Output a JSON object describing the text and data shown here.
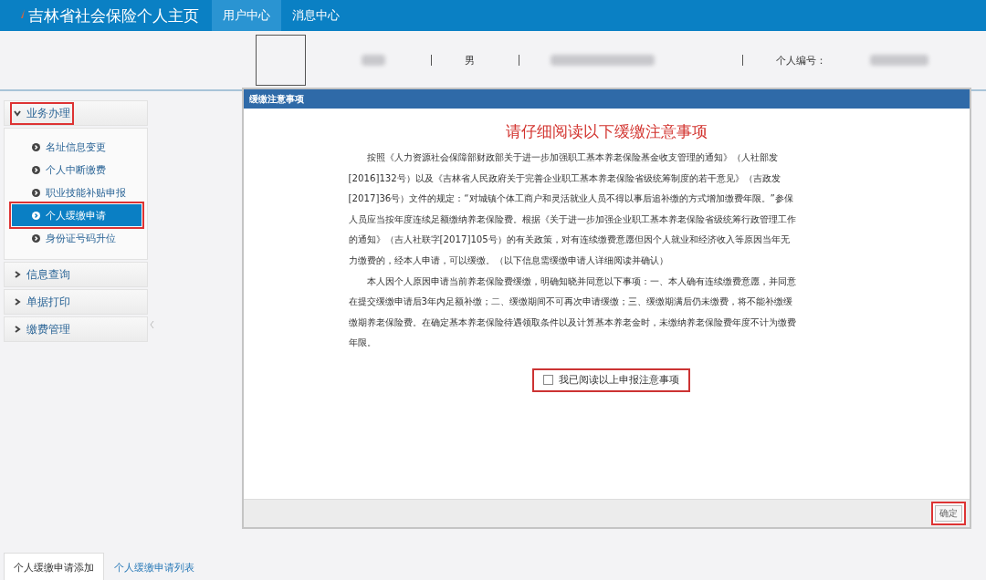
{
  "header": {
    "title": "吉林省社会保险个人主页",
    "nav": [
      {
        "label": "用户中心",
        "selected": true
      },
      {
        "label": "消息中心",
        "selected": false
      }
    ]
  },
  "profile": {
    "gender": "男",
    "id_label": "个人编号："
  },
  "sidebar": {
    "groups": [
      {
        "label": "业务办理",
        "expanded": true,
        "highlighted": true,
        "items": [
          {
            "label": "名址信息变更",
            "selected": false,
            "highlighted": false
          },
          {
            "label": "个人中断缴费",
            "selected": false,
            "highlighted": false
          },
          {
            "label": "职业技能补贴申报",
            "selected": false,
            "highlighted": false
          },
          {
            "label": "个人缓缴申请",
            "selected": true,
            "highlighted": true
          },
          {
            "label": "身份证号码升位",
            "selected": false,
            "highlighted": false
          }
        ]
      },
      {
        "label": "信息查询",
        "expanded": false,
        "highlighted": false
      },
      {
        "label": "单据打印",
        "expanded": false,
        "highlighted": false
      },
      {
        "label": "缴费管理",
        "expanded": false,
        "highlighted": false
      }
    ]
  },
  "dialog": {
    "title": "缓缴注意事项",
    "heading": "请仔细阅读以下缓缴注意事项",
    "paragraphs": [
      "按照《人力资源社会保障部财政部关于进一步加强职工基本养老保险基金收支管理的通知》（人社部发[2016]132号）以及《吉林省人民政府关于完善企业职工基本养老保险省级统筹制度的若干意见》（吉政发[2017]36号）文件的规定：“对城镇个体工商户和灵活就业人员不得以事后追补缴的方式增加缴费年限。”参保人员应当按年度连续足额缴纳养老保险费。根据《关于进一步加强企业职工基本养老保险省级统筹行政管理工作的通知》（吉人社联字[2017]105号）的有关政策，对有连续缴费意愿但因个人就业和经济收入等原因当年无力缴费的，经本人申请，可以缓缴。（以下信息需缓缴申请人详细阅读并确认）",
      "本人因个人原因申请当前养老保险费缓缴，明确知晓并同意以下事项：一、本人确有连续缴费意愿，并同意在提交缓缴申请后3年内足额补缴；二、缓缴期间不可再次申请缓缴；三、缓缴期满后仍未缴费，将不能补缴缓缴期养老保险费。在确定基本养老保险待遇领取条件以及计算基本养老金时，未缴纳养老保险费年度不计为缴费年限。"
    ],
    "agree": {
      "label": "我已阅读以上申报注意事项",
      "checked": false,
      "highlighted": true
    },
    "confirm": {
      "label": "确定",
      "highlighted": true
    }
  },
  "bottom_tabs": [
    {
      "label": "个人缓缴申请添加",
      "selected": true
    },
    {
      "label": "个人缓缴申请列表",
      "selected": false
    }
  ]
}
